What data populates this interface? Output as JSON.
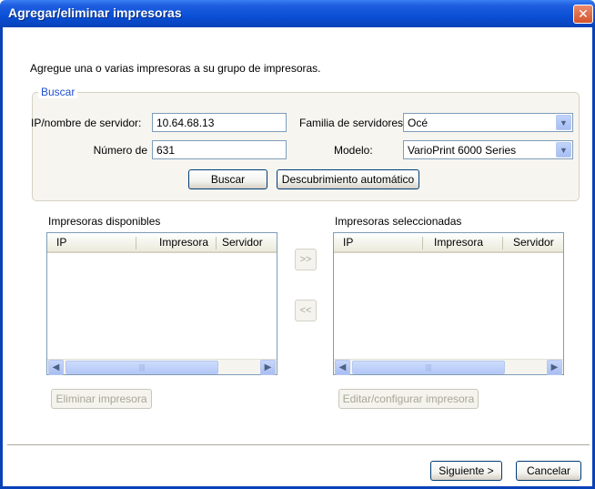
{
  "window": {
    "title": "Agregar/eliminar impresoras",
    "close_glyph": "✕"
  },
  "intro_text": "Agregue una o varias impresoras a su grupo de impresoras.",
  "search": {
    "group_label": "Buscar",
    "server_label": "IP/nombre de servidor:",
    "server_value": "10.64.68.13",
    "port_label": "Número de",
    "port_value": "631",
    "family_label": "Familia de servidores:",
    "family_value": "Océ",
    "model_label": "Modelo:",
    "model_value": "VarioPrint 6000 Series",
    "search_button": "Buscar",
    "auto_discover_button": "Descubrimiento automático"
  },
  "available": {
    "title": "Impresoras disponibles",
    "columns": [
      "IP",
      "Impresora",
      "Servidor"
    ],
    "rows": [],
    "remove_button": "Eliminar impresora"
  },
  "selected": {
    "title": "Impresoras seleccionadas",
    "columns": [
      "IP",
      "Impresora",
      "Servidor"
    ],
    "rows": [],
    "edit_button": "Editar/configurar impresora"
  },
  "transfer": {
    "add_glyph": ">>",
    "remove_glyph": "<<"
  },
  "footer": {
    "next_button": "Siguiente >",
    "cancel_button": "Cancelar"
  },
  "icons": {
    "close": "close-icon",
    "dropdown": "chevron-down-icon",
    "scroll_left": "chevron-left-icon",
    "scroll_right": "chevron-right-icon"
  },
  "colors": {
    "titlebar": "#0a4fd6",
    "close": "#d4532c",
    "group_label": "#2050d0"
  }
}
